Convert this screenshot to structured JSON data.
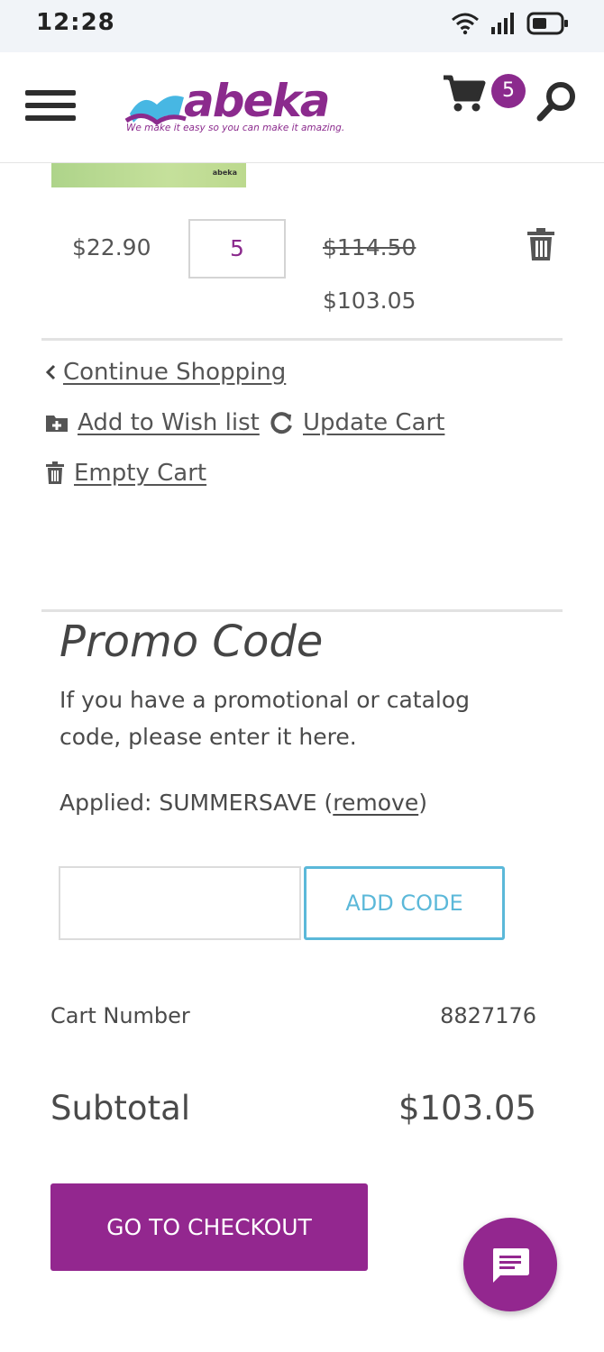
{
  "status_bar": {
    "time": "12:28"
  },
  "header": {
    "brand": "abeka",
    "tagline": "We make it easy so you can make it amazing.",
    "cart_count": "5"
  },
  "line_item": {
    "product_brand": "abeka",
    "unit_price": "$22.90",
    "quantity": "5",
    "original_total": "$114.50",
    "discounted_total": "$103.05"
  },
  "cart_actions": {
    "continue_shopping": "Continue Shopping",
    "add_to_wish_list": "Add to Wish list",
    "update_cart": "Update Cart",
    "empty_cart": "Empty Cart"
  },
  "promo": {
    "title": "Promo Code",
    "description": "If you have a promotional or catalog code, please enter it here.",
    "applied_prefix": "Applied: SUMMERSAVE (",
    "remove_label": "remove",
    "applied_suffix": ")",
    "input_value": "",
    "add_code_label": "ADD CODE"
  },
  "summary": {
    "cart_number_label": "Cart Number",
    "cart_number": "8827176",
    "subtotal_label": "Subtotal",
    "subtotal": "$103.05"
  },
  "checkout_label": "GO TO CHECKOUT",
  "colors": {
    "brand_purple": "#93278f",
    "accent_blue": "#5bb8d9"
  }
}
